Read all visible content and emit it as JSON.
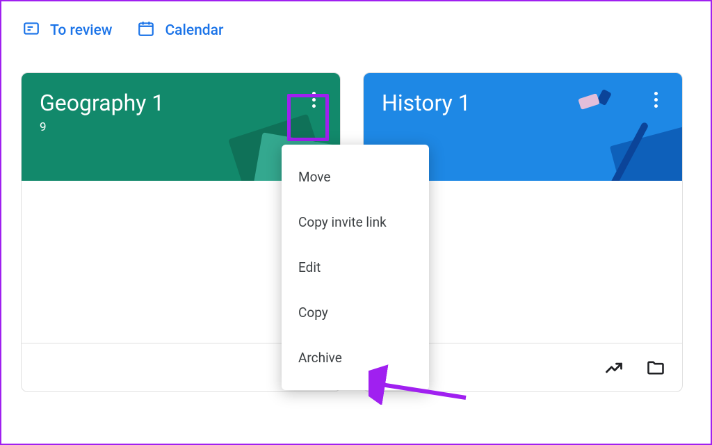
{
  "topbar": {
    "review": "To review",
    "calendar": "Calendar"
  },
  "cards": [
    {
      "title": "Geography 1",
      "subtitle": "9",
      "header_color": "#12896b"
    },
    {
      "title": "History 1",
      "subtitle": "",
      "header_color": "#1e88e5"
    }
  ],
  "menu": {
    "items": [
      "Move",
      "Copy invite link",
      "Edit",
      "Copy",
      "Archive"
    ]
  },
  "annotation": {
    "highlight_target": "card-0-more-button",
    "arrow_target": "menu-item-archive",
    "color": "#a020f0"
  }
}
